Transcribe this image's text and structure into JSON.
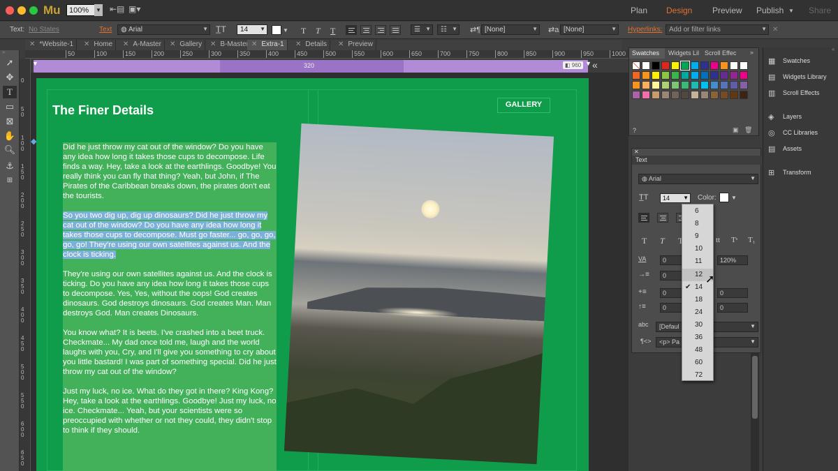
{
  "app": {
    "logo": "Mu",
    "zoom": "100%"
  },
  "modes": [
    {
      "label": "Plan"
    },
    {
      "label": "Design"
    },
    {
      "label": "Preview"
    },
    {
      "label": "Publish"
    },
    {
      "label": "Share"
    }
  ],
  "control_bar": {
    "states_label": "Text:",
    "states_value": "No States",
    "text_link": "Text",
    "font": "Arial",
    "size": "14",
    "para_none_1": "[None]",
    "char_none": "[None]",
    "hyperlinks_label": "Hyperlinks:",
    "hyperlinks_placeholder": "Add or filter links"
  },
  "tabs": [
    {
      "label": "*Website-1"
    },
    {
      "label": "Home"
    },
    {
      "label": "A-Master"
    },
    {
      "label": "Gallery"
    },
    {
      "label": "B-Master"
    },
    {
      "label": "Extra-1"
    },
    {
      "label": "Details"
    },
    {
      "label": "Preview"
    }
  ],
  "ruler_h": [
    "50",
    "100",
    "150",
    "200",
    "250",
    "300",
    "350",
    "400",
    "450",
    "500",
    "550",
    "600",
    "650",
    "700",
    "750",
    "800",
    "850",
    "900",
    "950",
    "1000"
  ],
  "ruler_v": [
    "0",
    "50",
    "100",
    "150",
    "200",
    "250",
    "300",
    "350",
    "400",
    "450",
    "500",
    "550",
    "600",
    "650"
  ],
  "breakpoints": {
    "min": "320",
    "max": "960"
  },
  "page": {
    "title": "The Finer Details",
    "gallery_button": "GALLERY",
    "paragraphs": [
      "Did he just throw my cat out of the window? Do you have any idea how long it takes those cups to decompose. Life finds a way. Hey, take a look at the earthlings. Goodbye! You really think you can fly that thing? Yeah, but John, if The Pirates of the Caribbean breaks down, the pirates don't eat the tourists.",
      "So you two dig up, dig up dinosaurs? Did he just throw my cat out of the window? Do you have any idea how long it takes those cups to decompose. Must go faster... go, go, go, go, go! They're using our own satellites against us. And the clock is ticking.",
      "They're using our own satellites against us. And the clock is ticking. Do you have any idea how long it takes those cups to decompose. Yes, Yes, without the oops! God creates dinosaurs. God destroys dinosaurs. God creates Man. Man destroys God. Man creates Dinosaurs.",
      "You know what? It is beets. I've crashed into a beet truck. Checkmate... My dad once told me, laugh and the world laughs with you, Cry, and I'll give you something to cry about you little bastard! I was part of something special. Did he just throw my cat out of the window?",
      "Just my luck, no ice. What do they got in there? King Kong? Hey, take a look at the earthlings. Goodbye! Just my luck, no ice. Checkmate... Yeah, but your scientists were so preoccupied with whether or not they could, they didn't stop to think if they should."
    ]
  },
  "swatches_panel": {
    "tabs": [
      "Swatches",
      "Widgets Lil",
      "Scroll Effec"
    ],
    "colors": [
      "#ffffff",
      "#ffffff",
      "#000000",
      "#e3241b",
      "#fff200",
      "#00a651",
      "#00aeef",
      "#2e3192",
      "#ec008c",
      "#f7941d",
      "#ffffff",
      "#ffffff",
      "#f26522",
      "#f7941d",
      "#fff200",
      "#8dc63f",
      "#39b54a",
      "#00a99d",
      "#00aeef",
      "#0072bc",
      "#2e3192",
      "#662d91",
      "#92278f",
      "#ec008c",
      "#f7941d",
      "#fbaf5d",
      "#fff799",
      "#acd373",
      "#7cc576",
      "#3cb878",
      "#1cbbb4",
      "#00bff3",
      "#448ccb",
      "#5674b9",
      "#605ca8",
      "#855fa8",
      "#a864a8",
      "#f06eaa",
      "#c69c6d",
      "#998675",
      "#736357",
      "#534741",
      "#c7b299",
      "#998675",
      "#8c6239",
      "#754c24",
      "#603913",
      "#3c2415"
    ]
  },
  "text_panel": {
    "title": "Text",
    "font": "Arial",
    "size": "14",
    "color_label": "Color:",
    "tracking": "0",
    "leading": "120%",
    "indent_before": "0",
    "indent_left": "0",
    "indent_right": "0",
    "space_before": "0",
    "space_after": "0",
    "para_style": "[Defaul",
    "tag": "<p> Pa"
  },
  "size_options": [
    "6",
    "8",
    "9",
    "10",
    "11",
    "12",
    "14",
    "18",
    "24",
    "30",
    "36",
    "48",
    "60",
    "72"
  ],
  "size_selected": "14",
  "size_hover": "12",
  "side_panel": [
    {
      "label": "Swatches"
    },
    {
      "label": "Widgets Library"
    },
    {
      "label": "Scroll Effects"
    },
    {
      "label": "Layers"
    },
    {
      "label": "CC Libraries"
    },
    {
      "label": "Assets"
    },
    {
      "label": "Transform"
    }
  ],
  "colors": {
    "page": "#0f9d4c",
    "accent": "#e2712f",
    "breakpoint": "#b28bd6",
    "highlight": "#7cb0d9"
  }
}
